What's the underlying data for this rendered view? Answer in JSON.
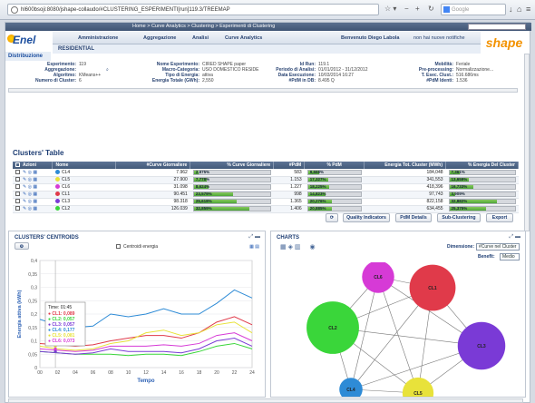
{
  "browser": {
    "url": "hl600bsoji:8080/jshape-collaudo/#CLUSTERING_ESPERIMENTI[run]119.3/TREEMAP",
    "search_placeholder": "Google"
  },
  "topbar": {
    "breadcrumb": "Home > Curve Analytics > Clustering > Esperimenti di Clustering"
  },
  "brand": {
    "logo_text": "Enel",
    "division": "Distribuzione",
    "product": "shape"
  },
  "menu": {
    "items": [
      "Amministrazione",
      "Aggregazione",
      "Analisi",
      "Curve Analytics"
    ],
    "welcome": "Benvenuto Diego Labola",
    "notice": "non hai nuove notifiche"
  },
  "header": {
    "title": "RESIDENTIAL"
  },
  "info": {
    "experiment_short": {
      "label": "Esperimento:",
      "value": "119"
    },
    "aggregation": {
      "label": "Aggregazione:",
      "value": ""
    },
    "algorithm": {
      "label": "Algoritmo:",
      "value": "KMeans++"
    },
    "clusters_count": {
      "label": "Numero di Cluster:",
      "value": "6"
    },
    "experiment_name": {
      "label": "Nome Esperimento:",
      "value": "CIRED SHAPE paper"
    },
    "macro_category": {
      "label": "Macro-Categoria:",
      "value": "USO DOMESTICO RESIDE"
    },
    "energy_type": {
      "label": "Tipo di Energia:",
      "value": "attiva"
    },
    "total_energy": {
      "label": "Energia Totale (GWh):",
      "value": "2,550"
    },
    "run_id": {
      "label": "Id Run:",
      "value": "119.1"
    },
    "analysis_period": {
      "label": "Periodo di Analisi:",
      "value": "01/01/2012 - 31/12/2012"
    },
    "execution_date": {
      "label": "Data Esecuzione:",
      "value": "10/03/2014 16:27"
    },
    "pdr_count": {
      "label": "#PdM in DB:",
      "value": "8.495 Q"
    },
    "mobility": {
      "label": "Mobilità:",
      "value": "Feriale"
    },
    "preprocessing": {
      "label": "Pre-processing:",
      "value": "Normalizzazione..."
    },
    "exec_time": {
      "label": "T. Esec. Clust.:",
      "value": "516.686ms"
    },
    "pdr_ident": {
      "label": "#PdM Identi:",
      "value": "1.536"
    }
  },
  "clusters_table": {
    "title": "Clusters' Table",
    "columns": [
      "Azioni",
      "Nome",
      "#Curve Giornaliere",
      "% Curve Giornaliere",
      "#PdM",
      "% PdM",
      "Energia Tot. Cluster (MWh)",
      "% Energia Del Cluster"
    ],
    "rows": [
      {
        "name": "CL4",
        "color": "#2e8bd6",
        "curves": "7.962",
        "curves_pct": "2,875%",
        "curves_frac": 0.029,
        "pdm": "583",
        "pdm_pct": "9,668%",
        "pdm_frac": 0.097,
        "energy": "184,048",
        "energy_pct": "7,361%",
        "energy_frac": 0.074
      },
      {
        "name": "CL5",
        "color": "#e8e23a",
        "curves": "27.900",
        "curves_pct": "7,778%",
        "curves_frac": 0.078,
        "pdm": "1.153",
        "pdm_pct": "17,327%",
        "pdm_frac": 0.173,
        "energy": "341,553",
        "energy_pct": "13,659%",
        "energy_frac": 0.137
      },
      {
        "name": "CL6",
        "color": "#d63ad6",
        "curves": "31.098",
        "curves_pct": "8,624%",
        "curves_frac": 0.086,
        "pdm": "1.227",
        "pdm_pct": "18,225%",
        "pdm_frac": 0.182,
        "energy": "418,396",
        "energy_pct": "16,733%",
        "energy_frac": 0.167
      },
      {
        "name": "CL1",
        "color": "#e03a4a",
        "curves": "90.451",
        "curves_pct": "23,579%",
        "curves_frac": 0.236,
        "pdm": "998",
        "pdm_pct": "14,823%",
        "pdm_frac": 0.148,
        "energy": "97,743",
        "energy_pct": "3,909%",
        "energy_frac": 0.039
      },
      {
        "name": "CL3",
        "color": "#7a3ad6",
        "curves": "98.318",
        "curves_pct": "25,618%",
        "curves_frac": 0.256,
        "pdm": "1.365",
        "pdm_pct": "20,276%",
        "pdm_frac": 0.203,
        "energy": "822,158",
        "energy_pct": "32,882%",
        "energy_frac": 0.329
      },
      {
        "name": "CL2",
        "color": "#3ad63a",
        "curves": "126.039",
        "curves_pct": "32,859%",
        "curves_frac": 0.329,
        "pdm": "1.406",
        "pdm_pct": "20,885%",
        "pdm_frac": 0.209,
        "energy": "634,455",
        "energy_pct": "25,375%",
        "energy_frac": 0.254
      }
    ],
    "buttons": [
      "Quality Indicators",
      "PdM Details",
      "Sub-Clustering",
      "Export"
    ]
  },
  "centroids": {
    "title": "CLUSTERS' CENTROIDS",
    "checkbox_label": "Centroidi energia",
    "ylabel": "Energia attiva (kWh)",
    "xlabel": "Tempo",
    "tooltip": {
      "time": "Time: 01:45",
      "items": [
        {
          "name": "CL1",
          "value": "0,089",
          "color": "#e03a4a"
        },
        {
          "name": "CL2",
          "value": "0,057",
          "color": "#3ad63a"
        },
        {
          "name": "CL3",
          "value": "0,057",
          "color": "#7a3ad6"
        },
        {
          "name": "CL4",
          "value": "0,177",
          "color": "#2e8bd6"
        },
        {
          "name": "CL5",
          "value": "0,081",
          "color": "#e8e23a"
        },
        {
          "name": "CL6",
          "value": "0,073",
          "color": "#d63ad6"
        }
      ]
    }
  },
  "charts_panel": {
    "title": "CHARTS",
    "dimension_label": "Dimensione:",
    "dimension_value": "#Curve nel Cluster",
    "rank_label": "Beneflt:",
    "rank_value": "Medio"
  },
  "chart_data": [
    {
      "type": "line",
      "title": "",
      "xlabel": "Tempo",
      "ylabel": "Energia attiva (kWh)",
      "x": [
        0,
        2,
        4,
        6,
        8,
        10,
        12,
        14,
        16,
        18,
        20,
        22,
        24
      ],
      "xlim": [
        0,
        24
      ],
      "ylim": [
        0,
        0.4
      ],
      "y_ticks": [
        0,
        0.05,
        0.1,
        0.15,
        0.2,
        0.25,
        0.3,
        0.35,
        0.4
      ],
      "series": [
        {
          "name": "CL1",
          "color": "#e03a4a",
          "values": [
            0.09,
            0.085,
            0.08,
            0.085,
            0.1,
            0.11,
            0.12,
            0.12,
            0.11,
            0.13,
            0.17,
            0.19,
            0.16
          ]
        },
        {
          "name": "CL2",
          "color": "#3ad63a",
          "values": [
            0.06,
            0.055,
            0.05,
            0.05,
            0.05,
            0.045,
            0.05,
            0.05,
            0.045,
            0.06,
            0.08,
            0.09,
            0.07
          ]
        },
        {
          "name": "CL3",
          "color": "#7a3ad6",
          "values": [
            0.06,
            0.055,
            0.05,
            0.055,
            0.07,
            0.06,
            0.06,
            0.06,
            0.055,
            0.07,
            0.1,
            0.11,
            0.08
          ]
        },
        {
          "name": "CL4",
          "color": "#2e8bd6",
          "values": [
            0.18,
            0.16,
            0.15,
            0.155,
            0.2,
            0.19,
            0.2,
            0.22,
            0.2,
            0.2,
            0.24,
            0.29,
            0.26
          ]
        },
        {
          "name": "CL5",
          "color": "#e8e23a",
          "values": [
            0.08,
            0.07,
            0.065,
            0.07,
            0.09,
            0.1,
            0.13,
            0.14,
            0.12,
            0.13,
            0.16,
            0.17,
            0.13
          ]
        },
        {
          "name": "CL6",
          "color": "#d63ad6",
          "values": [
            0.07,
            0.065,
            0.06,
            0.065,
            0.08,
            0.08,
            0.08,
            0.085,
            0.08,
            0.09,
            0.12,
            0.13,
            0.1
          ]
        }
      ]
    },
    {
      "type": "network",
      "nodes": [
        {
          "name": "CL6",
          "color": "#d63ad6",
          "size": 8.624
        },
        {
          "name": "CL1",
          "color": "#e03a4a",
          "size": 23.579
        },
        {
          "name": "CL2",
          "color": "#3ad63a",
          "size": 32.859
        },
        {
          "name": "CL3",
          "color": "#7a3ad6",
          "size": 25.618
        },
        {
          "name": "CL4",
          "color": "#2e8bd6",
          "size": 2.875
        },
        {
          "name": "CL5",
          "color": "#e8e23a",
          "size": 7.778
        }
      ]
    }
  ]
}
